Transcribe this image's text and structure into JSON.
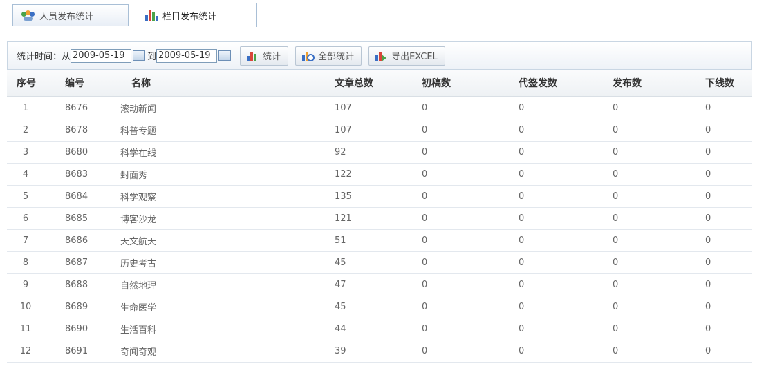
{
  "tabs": [
    {
      "label": "人员发布统计",
      "icon": "people-icon",
      "active": false
    },
    {
      "label": "栏目发布统计",
      "icon": "bar-chart-icon",
      "active": true
    }
  ],
  "toolbar": {
    "label": "统计时间：从",
    "from_value": "2009-05-19",
    "to_label": "到",
    "to_value": "2009-05-19",
    "stat_label": "统计",
    "all_stat_label": "全部统计",
    "export_label": "导出EXCEL"
  },
  "table": {
    "headers": [
      "序号",
      "编号",
      "名称",
      "文章总数",
      "初稿数",
      "代签发数",
      "发布数",
      "下线数"
    ],
    "rows": [
      [
        "1",
        "8676",
        "滚动新闻",
        "107",
        "0",
        "0",
        "0",
        "0"
      ],
      [
        "2",
        "8678",
        "科普专题",
        "107",
        "0",
        "0",
        "0",
        "0"
      ],
      [
        "3",
        "8680",
        "科学在线",
        "92",
        "0",
        "0",
        "0",
        "0"
      ],
      [
        "4",
        "8683",
        "封面秀",
        "122",
        "0",
        "0",
        "0",
        "0"
      ],
      [
        "5",
        "8684",
        "科学观察",
        "135",
        "0",
        "0",
        "0",
        "0"
      ],
      [
        "6",
        "8685",
        "博客沙龙",
        "121",
        "0",
        "0",
        "0",
        "0"
      ],
      [
        "7",
        "8686",
        "天文航天",
        "51",
        "0",
        "0",
        "0",
        "0"
      ],
      [
        "8",
        "8687",
        "历史考古",
        "45",
        "0",
        "0",
        "0",
        "0"
      ],
      [
        "9",
        "8688",
        "自然地理",
        "47",
        "0",
        "0",
        "0",
        "0"
      ],
      [
        "10",
        "8689",
        "生命医学",
        "45",
        "0",
        "0",
        "0",
        "0"
      ],
      [
        "11",
        "8690",
        "生活百科",
        "44",
        "0",
        "0",
        "0",
        "0"
      ],
      [
        "12",
        "8691",
        "奇闻奇观",
        "39",
        "0",
        "0",
        "0",
        "0"
      ]
    ]
  },
  "colors": {
    "border": "#a9bfd6",
    "bar_blue": "#3a6fc4",
    "bar_red": "#d8453a",
    "bar_green": "#4aa34a",
    "bar_orange": "#f0a030"
  }
}
